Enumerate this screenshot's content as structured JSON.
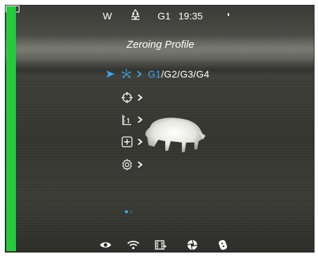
{
  "status_bar": {
    "wind_label": "W",
    "mode_icon": "tree-icon",
    "profile": "G1",
    "time": "19:35",
    "battery_level": 0.85,
    "battery_color": "#27c93f"
  },
  "menu": {
    "title": "Zeroing Profile",
    "items": [
      {
        "icon": "zeroing-fan-icon",
        "profiles_active": "G1",
        "profiles_rest": "/G2/G3/G4"
      },
      {
        "icon": "crosshair-icon"
      },
      {
        "icon": "ruler-icon"
      },
      {
        "icon": "add-square-icon"
      },
      {
        "icon": "settings-gear-icon"
      }
    ],
    "accent_color": "#3aa7f0"
  },
  "page_indicator": {
    "pages": 2,
    "current": 1
  },
  "bottom_bar": {
    "icons": [
      "eye-icon",
      "wifi-icon",
      "recording-icon",
      "shutter-icon",
      "remote-icon"
    ]
  }
}
